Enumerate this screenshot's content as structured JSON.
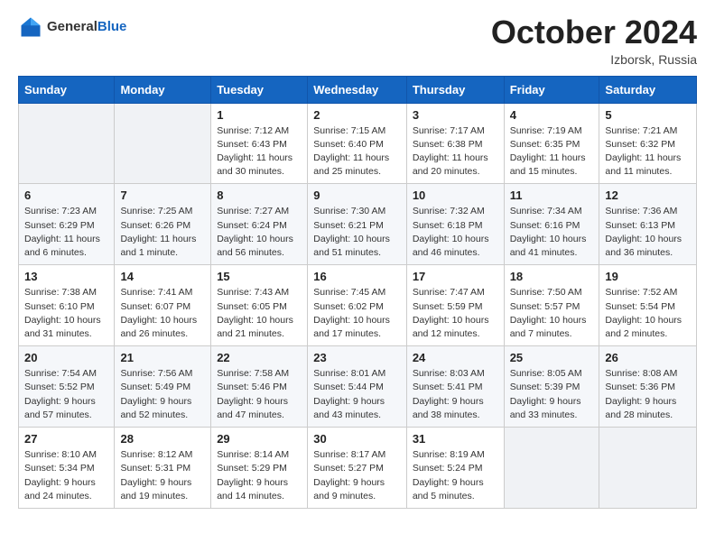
{
  "logo": {
    "general": "General",
    "blue": "Blue"
  },
  "title": "October 2024",
  "location": "Izborsk, Russia",
  "days_of_week": [
    "Sunday",
    "Monday",
    "Tuesday",
    "Wednesday",
    "Thursday",
    "Friday",
    "Saturday"
  ],
  "weeks": [
    [
      {
        "num": "",
        "info": ""
      },
      {
        "num": "",
        "info": ""
      },
      {
        "num": "1",
        "info": "Sunrise: 7:12 AM\nSunset: 6:43 PM\nDaylight: 11 hours\nand 30 minutes."
      },
      {
        "num": "2",
        "info": "Sunrise: 7:15 AM\nSunset: 6:40 PM\nDaylight: 11 hours\nand 25 minutes."
      },
      {
        "num": "3",
        "info": "Sunrise: 7:17 AM\nSunset: 6:38 PM\nDaylight: 11 hours\nand 20 minutes."
      },
      {
        "num": "4",
        "info": "Sunrise: 7:19 AM\nSunset: 6:35 PM\nDaylight: 11 hours\nand 15 minutes."
      },
      {
        "num": "5",
        "info": "Sunrise: 7:21 AM\nSunset: 6:32 PM\nDaylight: 11 hours\nand 11 minutes."
      }
    ],
    [
      {
        "num": "6",
        "info": "Sunrise: 7:23 AM\nSunset: 6:29 PM\nDaylight: 11 hours\nand 6 minutes."
      },
      {
        "num": "7",
        "info": "Sunrise: 7:25 AM\nSunset: 6:26 PM\nDaylight: 11 hours\nand 1 minute."
      },
      {
        "num": "8",
        "info": "Sunrise: 7:27 AM\nSunset: 6:24 PM\nDaylight: 10 hours\nand 56 minutes."
      },
      {
        "num": "9",
        "info": "Sunrise: 7:30 AM\nSunset: 6:21 PM\nDaylight: 10 hours\nand 51 minutes."
      },
      {
        "num": "10",
        "info": "Sunrise: 7:32 AM\nSunset: 6:18 PM\nDaylight: 10 hours\nand 46 minutes."
      },
      {
        "num": "11",
        "info": "Sunrise: 7:34 AM\nSunset: 6:16 PM\nDaylight: 10 hours\nand 41 minutes."
      },
      {
        "num": "12",
        "info": "Sunrise: 7:36 AM\nSunset: 6:13 PM\nDaylight: 10 hours\nand 36 minutes."
      }
    ],
    [
      {
        "num": "13",
        "info": "Sunrise: 7:38 AM\nSunset: 6:10 PM\nDaylight: 10 hours\nand 31 minutes."
      },
      {
        "num": "14",
        "info": "Sunrise: 7:41 AM\nSunset: 6:07 PM\nDaylight: 10 hours\nand 26 minutes."
      },
      {
        "num": "15",
        "info": "Sunrise: 7:43 AM\nSunset: 6:05 PM\nDaylight: 10 hours\nand 21 minutes."
      },
      {
        "num": "16",
        "info": "Sunrise: 7:45 AM\nSunset: 6:02 PM\nDaylight: 10 hours\nand 17 minutes."
      },
      {
        "num": "17",
        "info": "Sunrise: 7:47 AM\nSunset: 5:59 PM\nDaylight: 10 hours\nand 12 minutes."
      },
      {
        "num": "18",
        "info": "Sunrise: 7:50 AM\nSunset: 5:57 PM\nDaylight: 10 hours\nand 7 minutes."
      },
      {
        "num": "19",
        "info": "Sunrise: 7:52 AM\nSunset: 5:54 PM\nDaylight: 10 hours\nand 2 minutes."
      }
    ],
    [
      {
        "num": "20",
        "info": "Sunrise: 7:54 AM\nSunset: 5:52 PM\nDaylight: 9 hours\nand 57 minutes."
      },
      {
        "num": "21",
        "info": "Sunrise: 7:56 AM\nSunset: 5:49 PM\nDaylight: 9 hours\nand 52 minutes."
      },
      {
        "num": "22",
        "info": "Sunrise: 7:58 AM\nSunset: 5:46 PM\nDaylight: 9 hours\nand 47 minutes."
      },
      {
        "num": "23",
        "info": "Sunrise: 8:01 AM\nSunset: 5:44 PM\nDaylight: 9 hours\nand 43 minutes."
      },
      {
        "num": "24",
        "info": "Sunrise: 8:03 AM\nSunset: 5:41 PM\nDaylight: 9 hours\nand 38 minutes."
      },
      {
        "num": "25",
        "info": "Sunrise: 8:05 AM\nSunset: 5:39 PM\nDaylight: 9 hours\nand 33 minutes."
      },
      {
        "num": "26",
        "info": "Sunrise: 8:08 AM\nSunset: 5:36 PM\nDaylight: 9 hours\nand 28 minutes."
      }
    ],
    [
      {
        "num": "27",
        "info": "Sunrise: 8:10 AM\nSunset: 5:34 PM\nDaylight: 9 hours\nand 24 minutes."
      },
      {
        "num": "28",
        "info": "Sunrise: 8:12 AM\nSunset: 5:31 PM\nDaylight: 9 hours\nand 19 minutes."
      },
      {
        "num": "29",
        "info": "Sunrise: 8:14 AM\nSunset: 5:29 PM\nDaylight: 9 hours\nand 14 minutes."
      },
      {
        "num": "30",
        "info": "Sunrise: 8:17 AM\nSunset: 5:27 PM\nDaylight: 9 hours\nand 9 minutes."
      },
      {
        "num": "31",
        "info": "Sunrise: 8:19 AM\nSunset: 5:24 PM\nDaylight: 9 hours\nand 5 minutes."
      },
      {
        "num": "",
        "info": ""
      },
      {
        "num": "",
        "info": ""
      }
    ]
  ]
}
